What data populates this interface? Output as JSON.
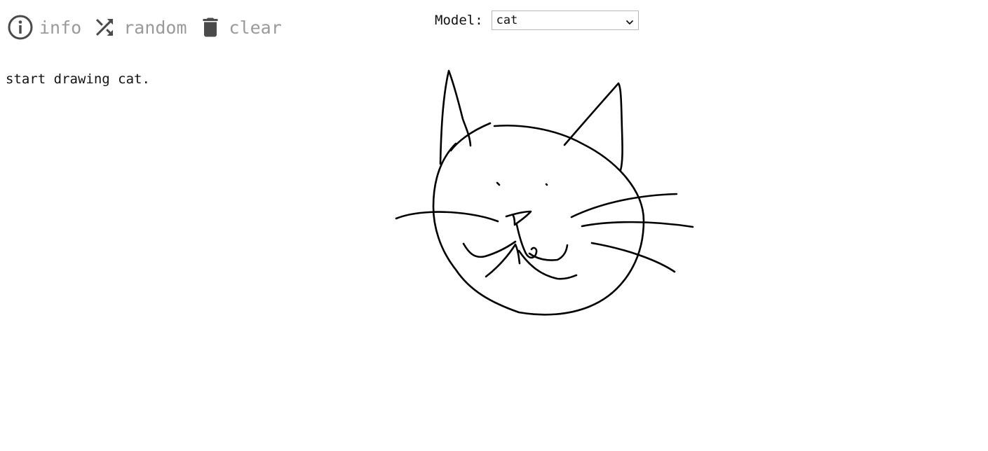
{
  "toolbar": {
    "info_label": "info",
    "random_label": "random",
    "clear_label": "clear",
    "info_icon": "info-icon",
    "random_icon": "shuffle-icon",
    "clear_icon": "trash-icon",
    "text_color": "#9a9a9a",
    "icon_color": "#4a4a4a"
  },
  "model": {
    "label": "Model:",
    "selected": "cat"
  },
  "status": {
    "text": "start drawing cat."
  },
  "drawing": {
    "subject": "cat",
    "stroke_color": "#000000"
  }
}
